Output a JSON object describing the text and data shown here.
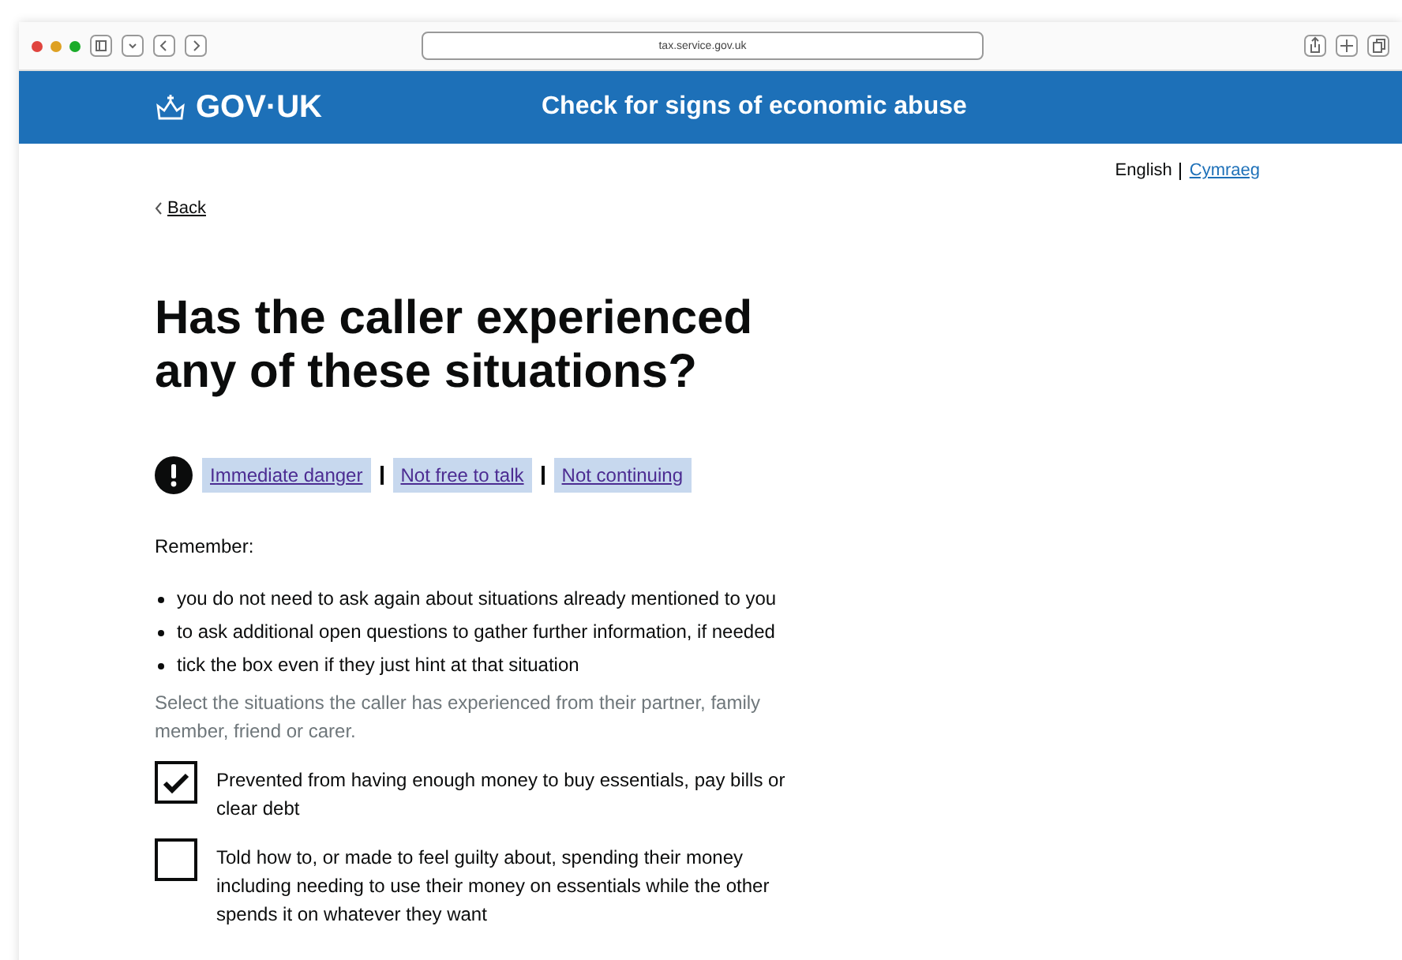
{
  "browser": {
    "url": "tax.service.gov.uk"
  },
  "header": {
    "logo": "GOV·UK",
    "service_name": "Check for signs of economic abuse"
  },
  "language": {
    "options": [
      {
        "label": "English",
        "selected": true
      },
      {
        "label": "Cymraeg",
        "selected": false
      }
    ]
  },
  "back_link": "Back",
  "title": "Has the caller experienced any of these situations?",
  "exit_links": [
    "Immediate danger",
    "Not free to talk",
    "Not continuing"
  ],
  "remember": {
    "heading": "Remember:",
    "items": [
      "you do not need to ask again about situations already mentioned to you",
      "to ask additional open questions to gather further information, if needed",
      "tick the box even if they just hint at that situation"
    ]
  },
  "hint": "Select the situations the caller has experienced from their partner, family member, friend or carer.",
  "situations": [
    {
      "label": "Prevented from having enough money to buy essentials, pay bills or clear debt",
      "checked": true
    },
    {
      "label": "Told how to, or made to feel guilty about, spending their money including needing to use their money on essentials while the other spends it on whatever they want",
      "checked": false
    }
  ]
}
